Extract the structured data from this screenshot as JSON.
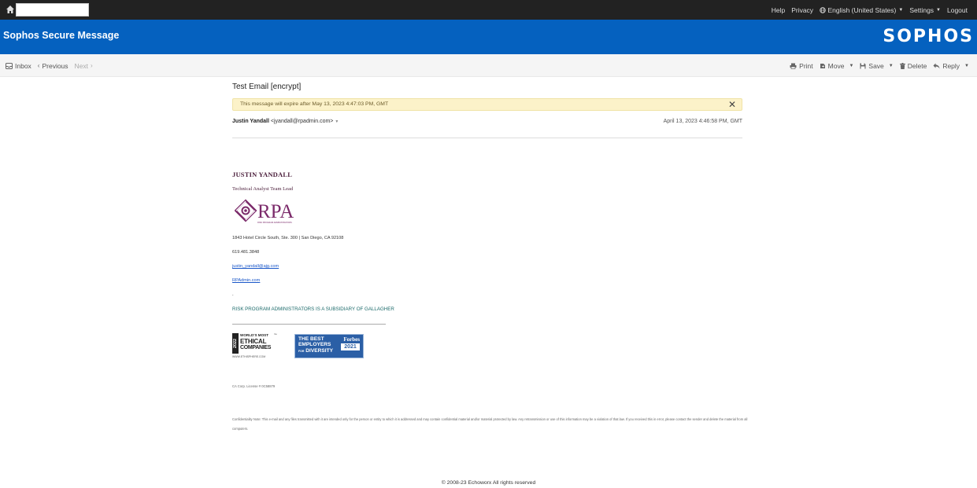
{
  "topbar": {
    "home_icon": "home-icon",
    "links": {
      "help": "Help",
      "privacy": "Privacy",
      "language": "English (United States)",
      "settings": "Settings",
      "logout": "Logout"
    }
  },
  "header": {
    "title": "Sophos Secure Message",
    "logo": "SOPHOS",
    "color": "#0561bf"
  },
  "toolbar": {
    "inbox": "Inbox",
    "previous": "Previous",
    "next": "Next",
    "print": "Print",
    "move": "Move",
    "save": "Save",
    "delete": "Delete",
    "reply": "Reply"
  },
  "message": {
    "subject": "Test Email [encrypt]",
    "expiry_notice": "This message will expire after May 13, 2023 4:47:03 PM, GMT",
    "sender_name": "Justin Yandall",
    "sender_email": "<jyandall@rpadmin.com>",
    "date": "April 13, 2023 4:46:58 PM, GMT"
  },
  "signature": {
    "name": "JUSTIN YANDALL",
    "role": "Technical Analyst Team Lead",
    "logo_text": "RPA",
    "logo_tagline": "RISK PROGRAM ADMINISTRATORS",
    "address": "1843 Hotel Circle South, Ste. 300 | San Diego, CA 92108",
    "phone": "619.481.3848",
    "email": "justin_yandall@ajg.com",
    "website": "RPAdmin.com",
    "dot": ".",
    "subsidiary": "RISK PROGRAM ADMINISTRATORS IS A SUBSIDIARY OF GALLAGHER",
    "ethics_badge": {
      "year": "2022",
      "line1": "WORLD'S MOST",
      "line2": "ETHICAL",
      "line3": "COMPANIES",
      "line4": "WWW.ETHISPHERE.COM",
      "tm": "™"
    },
    "forbes_badge": {
      "line1": "THE BEST",
      "line2": "EMPLOYERS",
      "line3_prefix": "FOR",
      "line3": "DIVERSITY",
      "brand": "Forbes",
      "year": "2021"
    },
    "license": "CA Corp. License # 0C58879",
    "confidentiality": "Confidentiality Note: This e-mail and any files transmitted with it are intended only for the person or entity to which it is addressed and may contain confidential material and/or material protected by law. Any retransmission or use of this information may be a violation of that law. If you received this in error, please contact the sender and delete the material from all computers."
  },
  "footer": {
    "copyright": "© 2008-23 Echoworx All rights reserved"
  }
}
